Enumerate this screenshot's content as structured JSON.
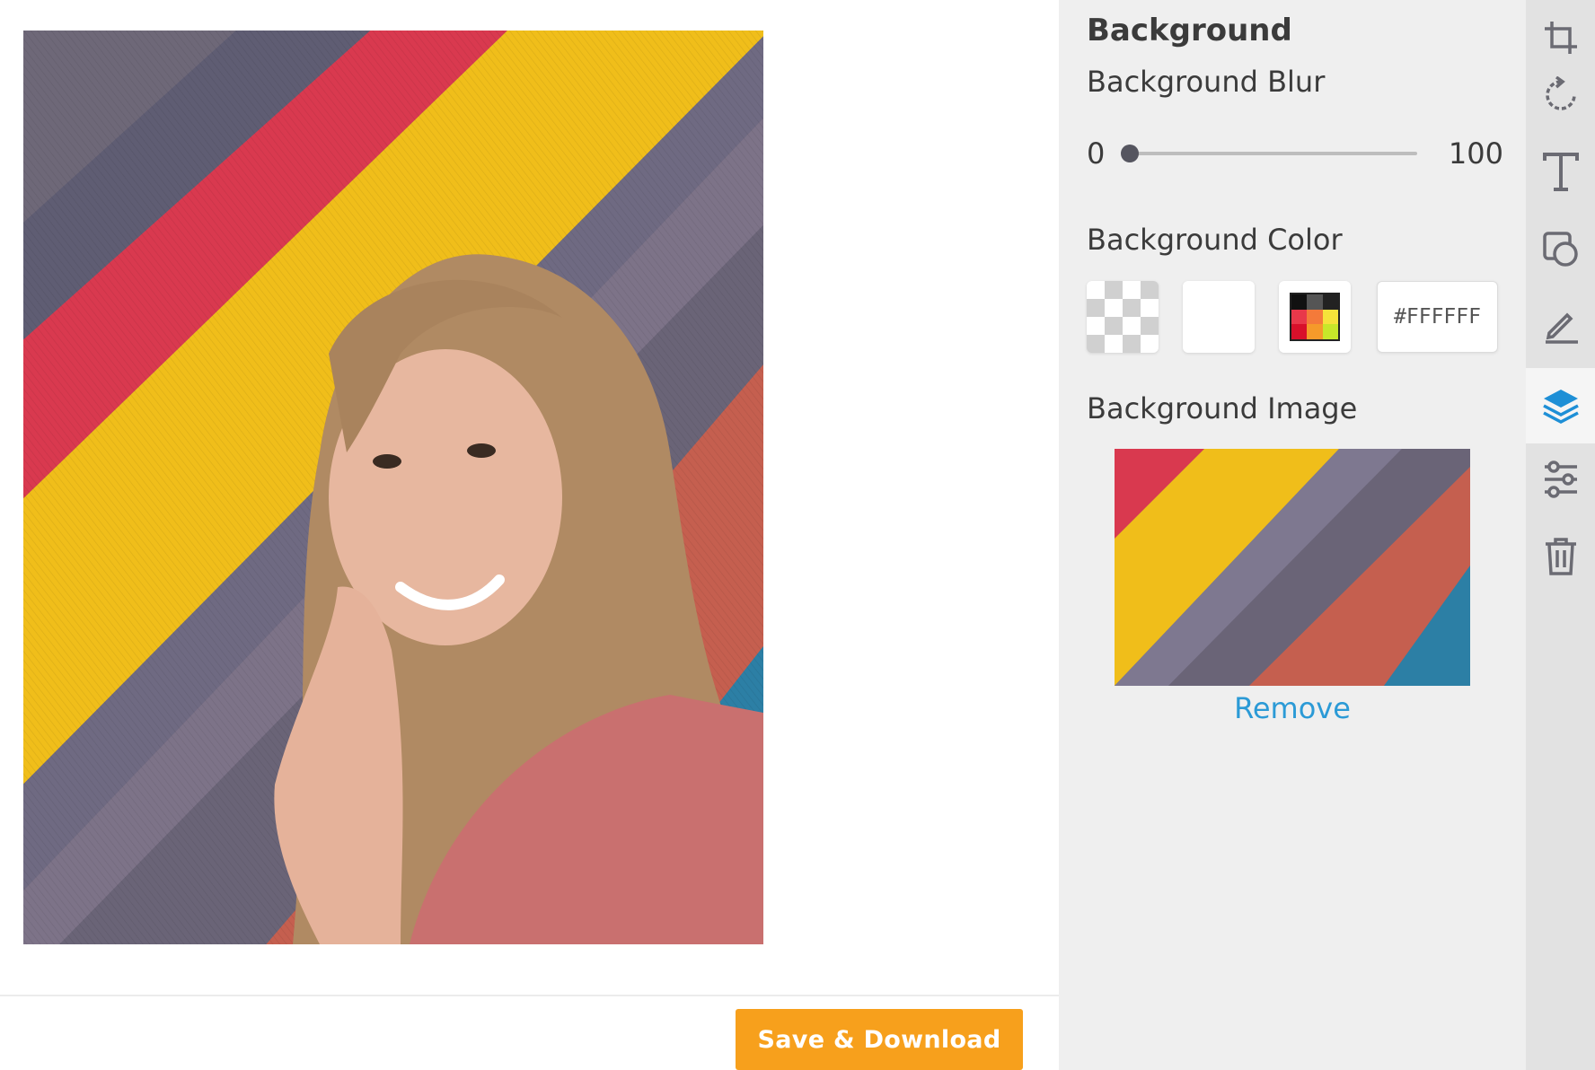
{
  "canvas": {
    "photo_alt": "Photo",
    "save_label": "Save & Download"
  },
  "panel": {
    "title": "Background",
    "blur": {
      "label": "Background Blur",
      "min": "0",
      "max": "100",
      "value": 0
    },
    "color": {
      "label": "Background Color",
      "hex_value": "#FFFFFF",
      "swatches": [
        "transparent-swatch",
        "white-swatch",
        "color-picker-swatch"
      ]
    },
    "image": {
      "label": "Background Image",
      "remove_label": "Remove"
    }
  },
  "tools": [
    {
      "name": "crop-icon",
      "active": false
    },
    {
      "name": "rotate-icon",
      "active": false
    },
    {
      "name": "text-icon",
      "active": false
    },
    {
      "name": "shapes-icon",
      "active": false
    },
    {
      "name": "draw-icon",
      "active": false
    },
    {
      "name": "layers-icon",
      "active": true
    },
    {
      "name": "adjust-icon",
      "active": false
    },
    {
      "name": "trash-icon",
      "active": false
    }
  ],
  "colors": {
    "accent_orange": "#f7a01c",
    "link_blue": "#2b9ad6",
    "active_tool_blue": "#1e8fd6",
    "icon_gray": "#6b6b73"
  }
}
